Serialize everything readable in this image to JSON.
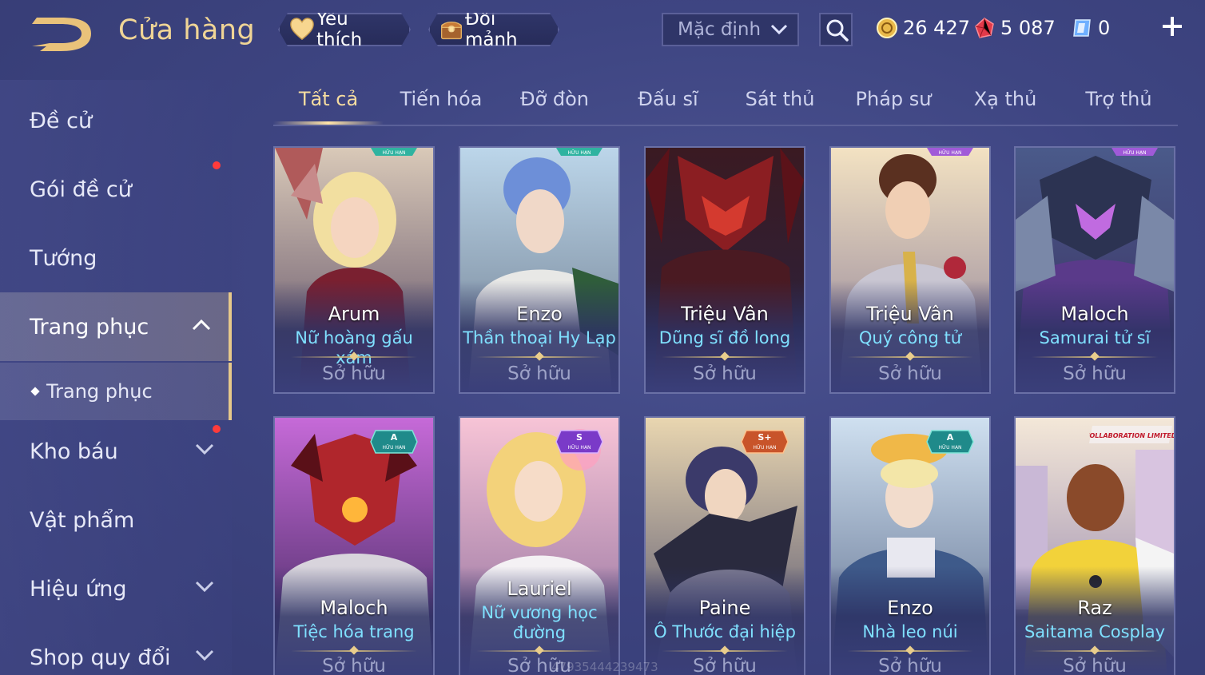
{
  "header": {
    "title": "Cửa hàng",
    "favorite_label": "Yêu thích",
    "shard_label": "Đổi mảnh",
    "sort_value": "Mặc định",
    "gold": "26 427",
    "ruby": "5 087",
    "voucher": "0"
  },
  "sidebar": {
    "items": [
      {
        "label": "Đề cử"
      },
      {
        "label": "Gói đề cử"
      },
      {
        "label": "Tướng"
      },
      {
        "label": "Trang phục"
      },
      {
        "label": "Trang phục"
      },
      {
        "label": "Kho báu"
      },
      {
        "label": "Vật phẩm"
      },
      {
        "label": "Hiệu ứng"
      },
      {
        "label": "Shop quy đổi"
      }
    ]
  },
  "tabs": [
    {
      "label": "Tất cả"
    },
    {
      "label": "Tiến hóa"
    },
    {
      "label": "Đỡ đòn"
    },
    {
      "label": "Đấu sĩ"
    },
    {
      "label": "Sát thủ"
    },
    {
      "label": "Pháp sư"
    },
    {
      "label": "Xạ thủ"
    },
    {
      "label": "Trợ thủ"
    }
  ],
  "cards": [
    {
      "hero": "Arum",
      "skin": "Nữ hoàng gấu xám",
      "status": "Sở hữu",
      "badge": "HỮU HẠN"
    },
    {
      "hero": "Enzo",
      "skin": "Thần thoại Hy Lạp",
      "status": "Sở hữu",
      "badge": "HỮU HẠN"
    },
    {
      "hero": "Triệu Vân",
      "skin": "Dũng sĩ đồ long",
      "status": "Sở hữu",
      "badge": ""
    },
    {
      "hero": "Triệu Vân",
      "skin": "Quý công tử",
      "status": "Sở hữu",
      "badge": "HỮU HẠN"
    },
    {
      "hero": "Maloch",
      "skin": "Samurai tử sĩ",
      "status": "Sở hữu",
      "badge": "HỮU HẠN"
    },
    {
      "hero": "Maloch",
      "skin": "Tiệc hóa trang",
      "status": "Sở hữu",
      "badge": "HỮU HẠN",
      "tier": "A"
    },
    {
      "hero": "Lauriel",
      "skin_line1": "Nữ vương học",
      "skin_line2": "đường",
      "status": "Sở hữu",
      "badge": "HỮU HẠN",
      "tier": "S"
    },
    {
      "hero": "Paine",
      "skin": "Ô Thước đại hiệp",
      "status": "Sở hữu",
      "badge": "HỮU HẠN",
      "tier": "S+"
    },
    {
      "hero": "Enzo",
      "skin": "Nhà leo núi",
      "status": "Sở hữu",
      "badge": "HỮU HẠN",
      "tier": "A"
    },
    {
      "hero": "Raz",
      "skin": "Saitama Cosplay",
      "status": "Sở hữu",
      "badge": "COLLABORATION LIMITED"
    }
  ],
  "watermark": "47935444239473",
  "colors": {
    "accent_gold": "#f0d596",
    "skin_name": "#7fe0ff",
    "background": "#3e4582",
    "red_dot": "#ff3b3b"
  }
}
